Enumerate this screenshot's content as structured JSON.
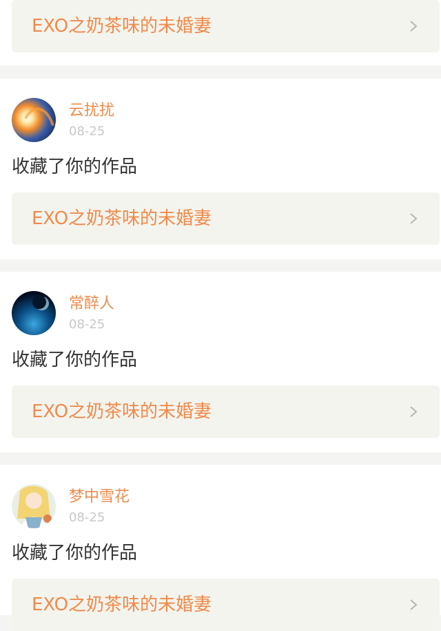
{
  "entries": [
    {
      "work_title": "EXO之奶茶味的未婚妻"
    },
    {
      "user_name": "云扰扰",
      "date": "08-25",
      "action": "收藏了你的作品",
      "work_title": "EXO之奶茶味的未婚妻"
    },
    {
      "user_name": "常醉人",
      "date": "08-25",
      "action": "收藏了你的作品",
      "work_title": "EXO之奶茶味的未婚妻"
    },
    {
      "user_name": "梦中雪花",
      "date": "08-25",
      "action": "收藏了你的作品",
      "work_title": "EXO之奶茶味的未婚妻"
    }
  ],
  "colors": {
    "accent": "#f08a4b",
    "card_bg": "#f4f4ee",
    "page_bg": "#f4f4f2",
    "text": "#333333",
    "muted": "#c8c8c8"
  },
  "icons": {
    "chevron": "chevron-right-icon"
  }
}
